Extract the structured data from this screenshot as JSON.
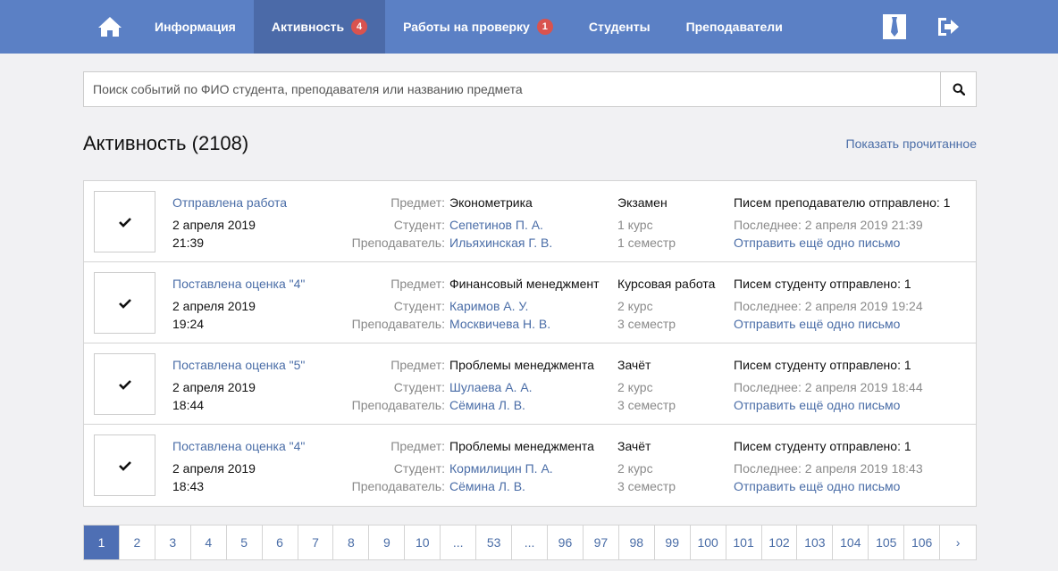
{
  "nav": {
    "items": [
      {
        "label": "Информация",
        "badge": ""
      },
      {
        "label": "Активность",
        "badge": "4"
      },
      {
        "label": "Работы на проверку",
        "badge": "1"
      },
      {
        "label": "Студенты",
        "badge": ""
      },
      {
        "label": "Преподаватели",
        "badge": ""
      }
    ],
    "icons": {
      "home": "home-icon",
      "role": "tie-icon",
      "logout": "logout-icon"
    }
  },
  "search": {
    "placeholder": "Поиск событий по ФИО студента, преподавателя или названию предмета"
  },
  "header": {
    "title": "Активность (2108)",
    "show_read": "Показать прочитанное"
  },
  "labels": {
    "subject": "Предмет:",
    "student": "Студент:",
    "teacher": "Преподаватель:"
  },
  "events": [
    {
      "title": "Отправлена работа",
      "date": "2 апреля 2019",
      "time": "21:39",
      "subject": "Эконометрика",
      "student": "Сепетинов П. А.",
      "teacher": "Ильяхинская Г. В.",
      "type": "Экзамен",
      "course": "1 курс",
      "semester": "1 семестр",
      "letters": "Писем преподавателю отправлено: 1",
      "last": "Последнее: 2 апреля 2019 21:39",
      "send": "Отправить ещё одно письмо"
    },
    {
      "title": "Поставлена оценка \"4\"",
      "date": "2 апреля 2019",
      "time": "19:24",
      "subject": "Финансовый менеджмент",
      "student": "Каримов А. У.",
      "teacher": "Москвичева Н. В.",
      "type": "Курсовая работа",
      "course": "2 курс",
      "semester": "3 семестр",
      "letters": "Писем студенту отправлено: 1",
      "last": "Последнее: 2 апреля 2019 19:24",
      "send": "Отправить ещё одно письмо"
    },
    {
      "title": "Поставлена оценка \"5\"",
      "date": "2 апреля 2019",
      "time": "18:44",
      "subject": "Проблемы менеджмента",
      "student": "Шулаева А. А.",
      "teacher": "Сёмина Л. В.",
      "type": "Зачёт",
      "course": "2 курс",
      "semester": "3 семестр",
      "letters": "Писем студенту отправлено: 1",
      "last": "Последнее: 2 апреля 2019 18:44",
      "send": "Отправить ещё одно письмо"
    },
    {
      "title": "Поставлена оценка \"4\"",
      "date": "2 апреля 2019",
      "time": "18:43",
      "subject": "Проблемы менеджмента",
      "student": "Кормилицин П. А.",
      "teacher": "Сёмина Л. В.",
      "type": "Зачёт",
      "course": "2 курс",
      "semester": "3 семестр",
      "letters": "Писем студенту отправлено: 1",
      "last": "Последнее: 2 апреля 2019 18:43",
      "send": "Отправить ещё одно письмо"
    }
  ],
  "pagination": {
    "pages": [
      "1",
      "2",
      "3",
      "4",
      "5",
      "6",
      "7",
      "8",
      "9",
      "10",
      "...",
      "53",
      "...",
      "96",
      "97",
      "98",
      "99",
      "100",
      "101",
      "102",
      "103",
      "104",
      "105",
      "106",
      "›"
    ],
    "current": "1"
  },
  "colors": {
    "navbar": "#5b80c5",
    "navbar_active": "#4b6aa8",
    "link": "#4a6da7",
    "badge": "#d9534f",
    "page_active": "#4e6fb4"
  }
}
